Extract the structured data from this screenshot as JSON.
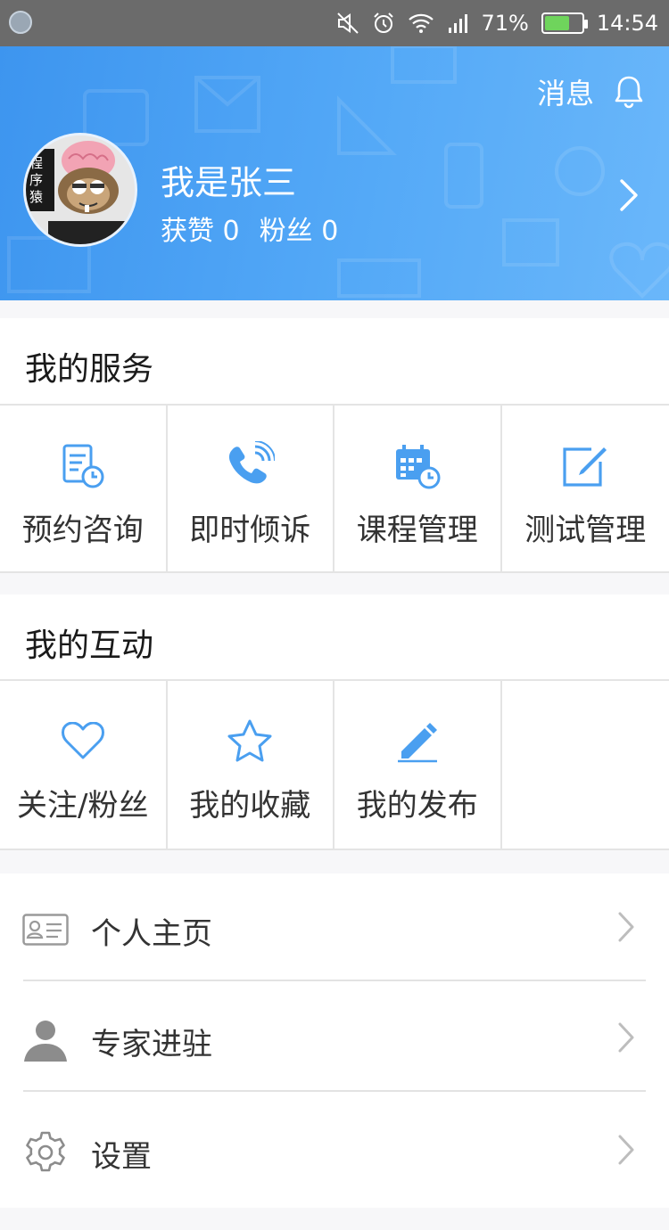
{
  "status_bar": {
    "battery_percent": "71%",
    "battery_level": 0.71,
    "time": "14:54",
    "icons": [
      "mute-icon",
      "alarm-icon",
      "wifi-icon",
      "signal-icon",
      "battery-icon"
    ]
  },
  "header": {
    "message_label": "消息",
    "username": "我是张三",
    "likes_label": "获赞",
    "likes_count": "0",
    "fans_label": "粉丝",
    "fans_count": "0",
    "avatar_text": "程序猿",
    "colors": {
      "bg_start": "#3d95ef",
      "bg_end": "#6ab7fa"
    }
  },
  "services": {
    "title": "我的服务",
    "items": [
      {
        "label": "预约咨询",
        "icon": "appointment-icon"
      },
      {
        "label": "即时倾诉",
        "icon": "phone-call-icon"
      },
      {
        "label": "课程管理",
        "icon": "calendar-clock-icon"
      },
      {
        "label": "测试管理",
        "icon": "edit-box-icon"
      }
    ]
  },
  "interactions": {
    "title": "我的互动",
    "items": [
      {
        "label": "关注/粉丝",
        "icon": "heart-icon"
      },
      {
        "label": "我的收藏",
        "icon": "star-icon"
      },
      {
        "label": "我的发布",
        "icon": "pencil-icon"
      }
    ]
  },
  "menu": [
    {
      "label": "个人主页",
      "icon": "id-card-icon"
    },
    {
      "label": "专家进驻",
      "icon": "user-icon"
    },
    {
      "label": "设置",
      "icon": "gear-icon"
    }
  ],
  "accent_color": "#4a9ff0"
}
